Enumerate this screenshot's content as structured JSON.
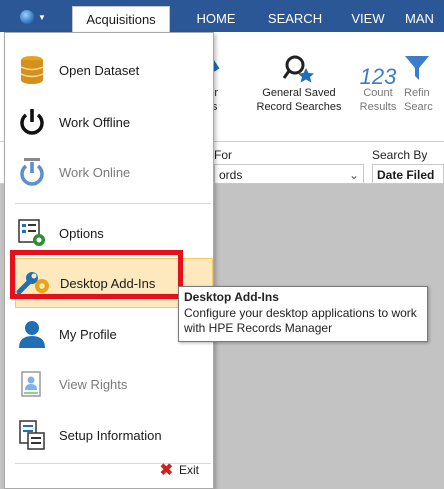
{
  "tabs": {
    "acquisitions": "Acquisitions",
    "home": "HOME",
    "search": "SEARCH",
    "view": "VIEW",
    "man": "MAN"
  },
  "ribbon": {
    "find_for": "h for\nords",
    "general_saved": "General Saved",
    "record_searches": "Record Searches",
    "count": "Count",
    "results": "Results",
    "refine": "Refin",
    "search_short": "Searc",
    "count_icon_text": "123"
  },
  "searchbar": {
    "for_label": "For",
    "records_value": "ords",
    "search_by_label": "Search By",
    "search_by_value": "Date Filed"
  },
  "menu": {
    "items": [
      {
        "label": "Open Dataset",
        "icon": "database-icon",
        "disabled": false
      },
      {
        "label": "Work Offline",
        "icon": "power-icon",
        "disabled": false
      },
      {
        "label": "Work Online",
        "icon": "power-online-icon",
        "disabled": true
      },
      {
        "label": "Options",
        "icon": "options-icon",
        "disabled": false
      },
      {
        "label": "Desktop Add-Ins",
        "icon": "wrench-gear-icon",
        "disabled": false
      },
      {
        "label": "My Profile",
        "icon": "user-icon",
        "disabled": false
      },
      {
        "label": "View Rights",
        "icon": "rights-icon",
        "disabled": true
      },
      {
        "label": "Setup Information",
        "icon": "setup-info-icon",
        "disabled": false
      }
    ],
    "exit_label": "Exit"
  },
  "tooltip": {
    "title": "Desktop Add-Ins",
    "body": "Configure your desktop applications to work with HPE Records Manager"
  },
  "colors": {
    "ribbon_blue": "#2b5797",
    "hover": "#fde9bd",
    "highlight_red": "#e4101b"
  }
}
